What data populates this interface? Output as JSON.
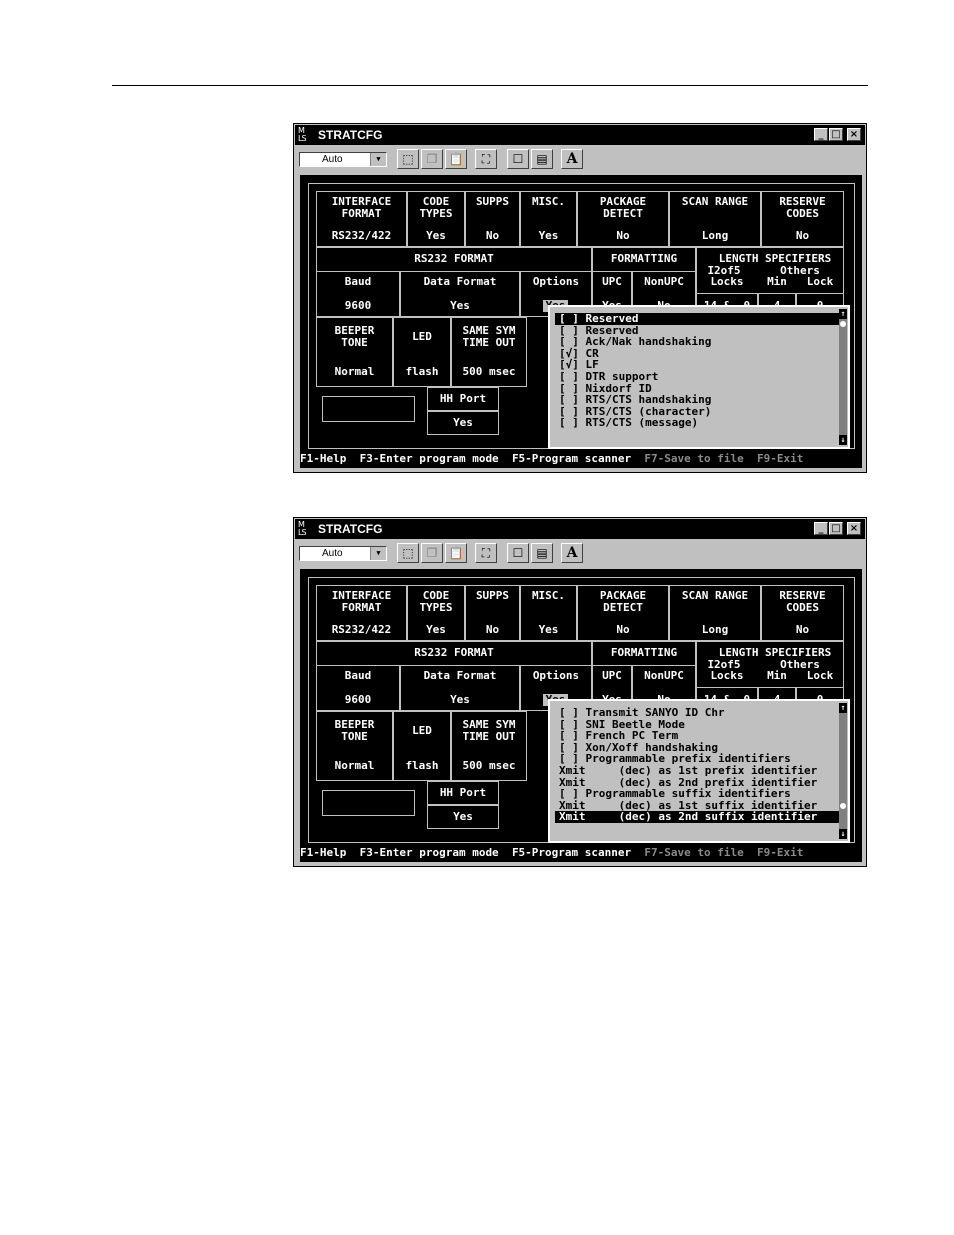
{
  "windows": [
    {
      "title": "STRATCFG",
      "icon_text": "M\nLS",
      "toolbar": {
        "combo_value": "Auto",
        "text_button": "A"
      },
      "table": {
        "headers": [
          "INTERFACE\nFORMAT",
          "CODE\nTYPES",
          "SUPPS",
          "MISC.",
          "PACKAGE\nDETECT",
          "SCAN RANGE",
          "RESERVE\nCODES"
        ],
        "values": [
          "RS232/422",
          "Yes",
          "No",
          "Yes",
          "No",
          "Long",
          "No"
        ],
        "rs232_title": "RS232 FORMAT",
        "rs232_cols": [
          "Baud",
          "Data Format",
          "Options"
        ],
        "rs232_vals": [
          "9600",
          "Yes",
          "Yes"
        ],
        "formatting_title": "FORMATTING",
        "formatting_cols": [
          "UPC",
          "NonUPC"
        ],
        "formatting_vals": [
          "Yes",
          "No"
        ],
        "length_title": "LENGTH SPECIFIERS",
        "length_sub": [
          "I2of5",
          "Others"
        ],
        "length_cols": [
          "Locks",
          "Min",
          "Lock"
        ],
        "length_vals": [
          "14 &  0",
          "4",
          "0"
        ],
        "beeper_head": [
          "BEEPER\nTONE",
          "LED"
        ],
        "beeper_vals": [
          "Normal",
          "flash"
        ],
        "same_sym_head": "SAME SYM\nTIME OUT",
        "same_sym_val": "500 msec",
        "hh_port_head": "HH Port",
        "hh_port_val": "Yes"
      },
      "popup": {
        "items": [
          "[ ] Reserved",
          "[ ] Reserved",
          "[ ] Ack/Nak handshaking",
          "[√] CR",
          "[√] LF",
          "[ ] DTR support",
          "[ ] Nixdorf ID",
          "[ ] RTS/CTS handshaking",
          "[ ] RTS/CTS (character)",
          "[ ] RTS/CTS (message)"
        ],
        "selected_index": 0
      },
      "status": {
        "f1": "F1-Help",
        "f3": "F3-Enter program mode",
        "f5": "F5-Program scanner",
        "f7": "F7-Save to file",
        "f9": "F9-Exit"
      }
    },
    {
      "title": "STRATCFG",
      "icon_text": "M\nLS",
      "toolbar": {
        "combo_value": "Auto",
        "text_button": "A"
      },
      "table": {
        "headers": [
          "INTERFACE\nFORMAT",
          "CODE\nTYPES",
          "SUPPS",
          "MISC.",
          "PACKAGE\nDETECT",
          "SCAN RANGE",
          "RESERVE\nCODES"
        ],
        "values": [
          "RS232/422",
          "Yes",
          "No",
          "Yes",
          "No",
          "Long",
          "No"
        ],
        "rs232_title": "RS232 FORMAT",
        "rs232_cols": [
          "Baud",
          "Data Format",
          "Options"
        ],
        "rs232_vals": [
          "9600",
          "Yes",
          "Yes"
        ],
        "formatting_title": "FORMATTING",
        "formatting_cols": [
          "UPC",
          "NonUPC"
        ],
        "formatting_vals": [
          "Yes",
          "No"
        ],
        "length_title": "LENGTH SPECIFIERS",
        "length_sub": [
          "I2of5",
          "Others"
        ],
        "length_cols": [
          "Locks",
          "Min",
          "Lock"
        ],
        "length_vals": [
          "14 &  0",
          "4",
          "0"
        ],
        "beeper_head": [
          "BEEPER\nTONE",
          "LED"
        ],
        "beeper_vals": [
          "Normal",
          "flash"
        ],
        "same_sym_head": "SAME SYM\nTIME OUT",
        "same_sym_val": "500 msec",
        "hh_port_head": "HH Port",
        "hh_port_val": "Yes"
      },
      "popup": {
        "items": [
          "[ ] Transmit SANYO ID Chr",
          "[ ] SNI Beetle Mode",
          "[ ] French PC Term",
          "[ ] Xon/Xoff handshaking",
          "[ ] Programmable prefix identifiers",
          "Xmit     (dec) as 1st prefix identifier",
          "Xmit     (dec) as 2nd prefix identifier",
          "[ ] Programmable suffix identifiers",
          "Xmit     (dec) as 1st suffix identifier",
          "Xmit     (dec) as 2nd suffix identifier"
        ],
        "selected_index": 9
      },
      "status": {
        "f1": "F1-Help",
        "f3": "F3-Enter program mode",
        "f5": "F5-Program scanner",
        "f7": "F7-Save to file",
        "f9": "F9-Exit"
      }
    }
  ]
}
